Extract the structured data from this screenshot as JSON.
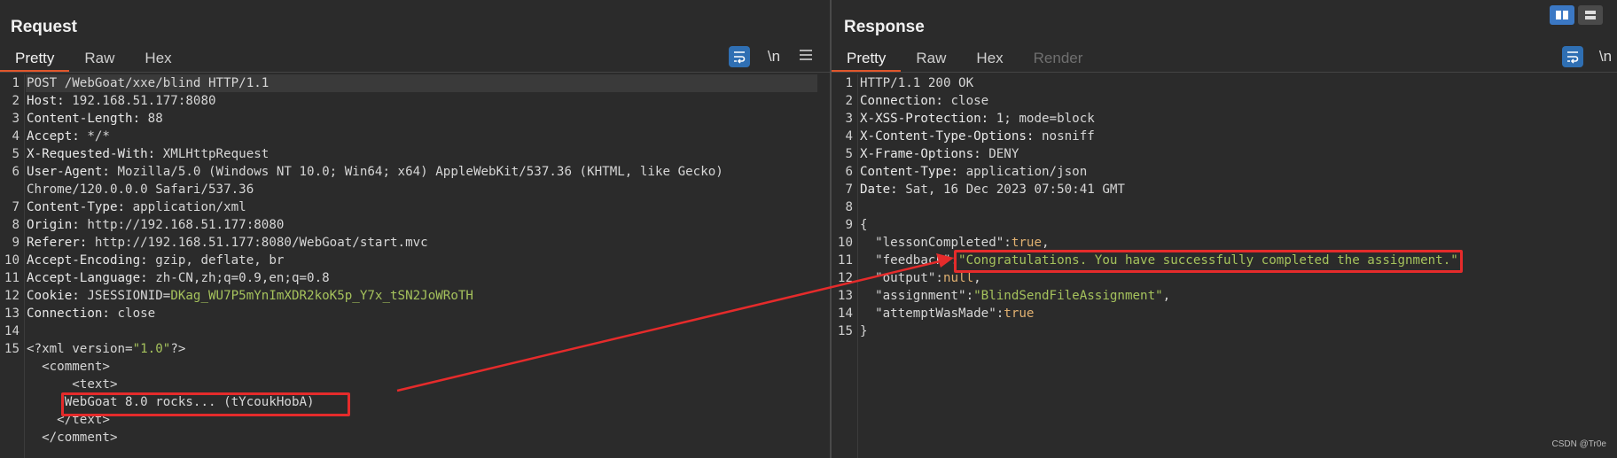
{
  "request": {
    "title": "Request",
    "tabs": [
      "Pretty",
      "Raw",
      "Hex"
    ],
    "active_tab": "Pretty",
    "tools": {
      "wrap_icon": "wrap-lines-icon",
      "newline_label": "\\n",
      "menu_icon": "hamburger-menu-icon"
    },
    "lines": [
      {
        "n": "1",
        "parts": [
          [
            "hv",
            "POST /WebGoat/xxe/blind HTTP/1.1"
          ]
        ]
      },
      {
        "n": "2",
        "parts": [
          [
            "hk",
            "Host: "
          ],
          [
            "hv",
            "192.168.51.177:8080"
          ]
        ]
      },
      {
        "n": "3",
        "parts": [
          [
            "hk",
            "Content-Length: "
          ],
          [
            "hv",
            "88"
          ]
        ]
      },
      {
        "n": "4",
        "parts": [
          [
            "hk",
            "Accept: "
          ],
          [
            "hv",
            "*/*"
          ]
        ]
      },
      {
        "n": "5",
        "parts": [
          [
            "hk",
            "X-Requested-With: "
          ],
          [
            "hv",
            "XMLHttpRequest"
          ]
        ]
      },
      {
        "n": "6",
        "parts": [
          [
            "hk",
            "User-Agent: "
          ],
          [
            "hv",
            "Mozilla/5.0 (Windows NT 10.0; Win64; x64) AppleWebKit/537.36 (KHTML, like Gecko)"
          ]
        ]
      },
      {
        "n": "",
        "parts": [
          [
            "hv",
            "Chrome/120.0.0.0 Safari/537.36"
          ]
        ]
      },
      {
        "n": "7",
        "parts": [
          [
            "hk",
            "Content-Type: "
          ],
          [
            "hv",
            "application/xml"
          ]
        ]
      },
      {
        "n": "8",
        "parts": [
          [
            "hk",
            "Origin: "
          ],
          [
            "hv",
            "http://192.168.51.177:8080"
          ]
        ]
      },
      {
        "n": "9",
        "parts": [
          [
            "hk",
            "Referer: "
          ],
          [
            "hv",
            "http://192.168.51.177:8080/WebGoat/start.mvc"
          ]
        ]
      },
      {
        "n": "10",
        "parts": [
          [
            "hk",
            "Accept-Encoding: "
          ],
          [
            "hv",
            "gzip, deflate, br"
          ]
        ]
      },
      {
        "n": "11",
        "parts": [
          [
            "hk",
            "Accept-Language: "
          ],
          [
            "hv",
            "zh-CN,zh;q=0.9,en;q=0.8"
          ]
        ]
      },
      {
        "n": "12",
        "parts": [
          [
            "hk",
            "Cookie: "
          ],
          [
            "hv",
            "JSESSIONID="
          ],
          [
            "cv",
            "DKag_WU7P5mYnImXDR2koK5p_Y7x_tSN2JoWRoTH"
          ]
        ]
      },
      {
        "n": "13",
        "parts": [
          [
            "hk",
            "Connection: "
          ],
          [
            "hv",
            "close"
          ]
        ]
      },
      {
        "n": "14",
        "parts": []
      },
      {
        "n": "15",
        "parts": [
          [
            "xml-tag",
            "<?xml version="
          ],
          [
            "xml-str",
            "\"1.0\""
          ],
          [
            "xml-tag",
            "?>"
          ]
        ]
      },
      {
        "n": "",
        "parts": [
          [
            "xml-tag",
            "  <comment>"
          ]
        ]
      },
      {
        "n": "",
        "parts": [
          [
            "xml-tag",
            "      <text>"
          ]
        ]
      },
      {
        "n": "",
        "parts": [
          [
            "hv",
            "     WebGoat 8.0 rocks... (tYcoukHobA)"
          ]
        ]
      },
      {
        "n": "",
        "parts": [
          [
            "xml-tag",
            "    </text>"
          ]
        ]
      },
      {
        "n": "",
        "parts": [
          [
            "xml-tag",
            "  </comment>"
          ]
        ]
      }
    ]
  },
  "response": {
    "title": "Response",
    "tabs": [
      "Pretty",
      "Raw",
      "Hex",
      "Render"
    ],
    "active_tab": "Pretty",
    "disabled_tab": "Render",
    "tools": {
      "wrap_icon": "wrap-lines-icon",
      "newline_label": "\\n"
    },
    "lines": [
      {
        "n": "1",
        "parts": [
          [
            "hv",
            "HTTP/1.1 200 OK"
          ]
        ]
      },
      {
        "n": "2",
        "parts": [
          [
            "hk",
            "Connection: "
          ],
          [
            "hv",
            "close"
          ]
        ]
      },
      {
        "n": "3",
        "parts": [
          [
            "hk",
            "X-XSS-Protection: "
          ],
          [
            "hv",
            "1; mode=block"
          ]
        ]
      },
      {
        "n": "4",
        "parts": [
          [
            "hk",
            "X-Content-Type-Options: "
          ],
          [
            "hv",
            "nosniff"
          ]
        ]
      },
      {
        "n": "5",
        "parts": [
          [
            "hk",
            "X-Frame-Options: "
          ],
          [
            "hv",
            "DENY"
          ]
        ]
      },
      {
        "n": "6",
        "parts": [
          [
            "hk",
            "Content-Type: "
          ],
          [
            "hv",
            "application/json"
          ]
        ]
      },
      {
        "n": "7",
        "parts": [
          [
            "hk",
            "Date: "
          ],
          [
            "hv",
            "Sat, 16 Dec 2023 07:50:41 GMT"
          ]
        ]
      },
      {
        "n": "8",
        "parts": []
      },
      {
        "n": "9",
        "parts": [
          [
            "jk",
            "{"
          ]
        ]
      },
      {
        "n": "10",
        "parts": [
          [
            "jk",
            "  \"lessonCompleted\":"
          ],
          [
            "jl",
            "true"
          ],
          [
            "jk",
            ","
          ]
        ]
      },
      {
        "n": "11",
        "parts": [
          [
            "jk",
            "  \"feedback\":"
          ],
          [
            "js",
            "\"Congratulations. You have successfully completed the assignment.\""
          ],
          [
            "jk",
            ","
          ]
        ]
      },
      {
        "n": "12",
        "parts": [
          [
            "jk",
            "  \"output\":"
          ],
          [
            "jl",
            "null"
          ],
          [
            "jk",
            ","
          ]
        ]
      },
      {
        "n": "13",
        "parts": [
          [
            "jk",
            "  \"assignment\":"
          ],
          [
            "js",
            "\"BlindSendFileAssignment\""
          ],
          [
            "jk",
            ","
          ]
        ]
      },
      {
        "n": "14",
        "parts": [
          [
            "jk",
            "  \"attemptWasMade\":"
          ],
          [
            "jl",
            "true"
          ]
        ]
      },
      {
        "n": "15",
        "parts": [
          [
            "jk",
            "}"
          ]
        ]
      }
    ]
  },
  "layout_buttons": {
    "split_icon": "side-by-side-layout-icon",
    "stack_icon": "stacked-layout-icon"
  },
  "colors": {
    "accent": "#e0562c",
    "highlight_box": "#e52b2b",
    "wrap_button": "#2f6fb3"
  },
  "watermark": "CSDN @Tr0e"
}
